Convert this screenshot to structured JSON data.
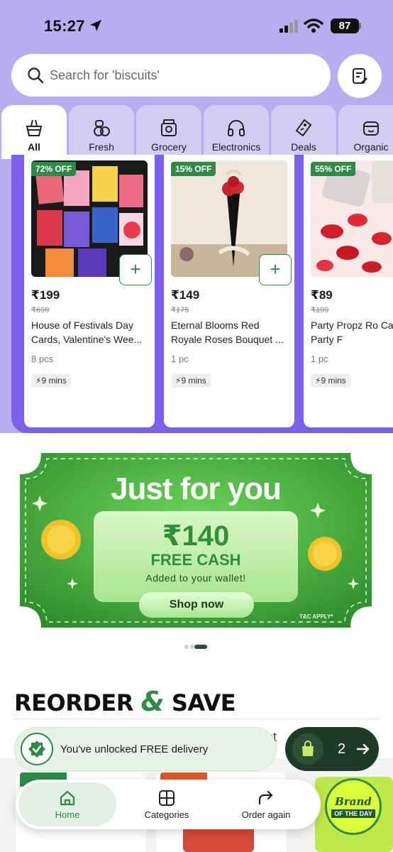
{
  "status_bar": {
    "time": "15:27",
    "battery": "87"
  },
  "search": {
    "placeholder": "Search for 'biscuits'"
  },
  "tabs": [
    {
      "label": "All",
      "icon": "basket-icon",
      "active": true
    },
    {
      "label": "Fresh",
      "icon": "fruit-icon"
    },
    {
      "label": "Grocery",
      "icon": "grocery-jar-icon"
    },
    {
      "label": "Electronics",
      "icon": "headphones-icon"
    },
    {
      "label": "Deals",
      "icon": "tag-icon"
    },
    {
      "label": "Organic",
      "icon": "organic-bowl-icon"
    }
  ],
  "products": [
    {
      "badge": "72% OFF",
      "price": "₹199",
      "mrp": "₹699",
      "name": "House of Festivals Day Cards, Valentine's Wee...",
      "qty": "8 pcs",
      "eta": "9 mins"
    },
    {
      "badge": "15% OFF",
      "price": "₹149",
      "mrp": "₹175",
      "name": "Eternal Blooms Red Royale Roses Bouquet ...",
      "qty": "1 pc",
      "eta": "9 mins"
    },
    {
      "badge": "55% OFF",
      "price": "₹89",
      "mrp": "₹199",
      "name": "Party Propz Ro Cannon Party F",
      "qty": "1 pc",
      "eta": "9 mins"
    }
  ],
  "banner": {
    "title": "Just for you",
    "amount": "₹140",
    "free_cash": "FREE CASH",
    "added": "Added to your wallet!",
    "cta": "Shop now",
    "tnc": "T&C APPLY*"
  },
  "reorder": {
    "title_a": "REORDER ",
    "amp": "&",
    "title_b": " SAVE",
    "peek": "st"
  },
  "toast": {
    "text": "You've unlocked FREE delivery"
  },
  "cart": {
    "count": "2"
  },
  "bottom_nav": [
    {
      "label": "Home",
      "icon": "home-icon"
    },
    {
      "label": "Categories",
      "icon": "categories-grid-icon"
    },
    {
      "label": "Order again",
      "icon": "reorder-arrow-icon"
    }
  ],
  "brand_of_day": {
    "line1": "Brand",
    "line2": "OF THE DAY"
  }
}
